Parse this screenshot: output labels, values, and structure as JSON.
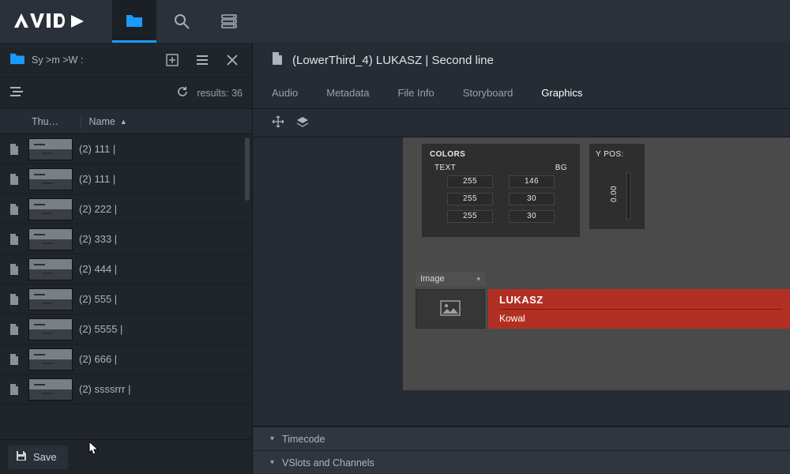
{
  "nav": {
    "tab_files": "files",
    "tab_search": "search",
    "tab_servers": "servers"
  },
  "browser": {
    "breadcrumb": "Sy  >m  >W :",
    "results_label": "results:",
    "results_count": "36",
    "col_thumb": "Thu…",
    "col_name": "Name",
    "sort_dir": "▲",
    "save_label": "Save",
    "items": [
      {
        "name": "(2) 111 |"
      },
      {
        "name": "(2) 111 |"
      },
      {
        "name": "(2) 222 |"
      },
      {
        "name": "(2) 333 |"
      },
      {
        "name": "(2) 444 |"
      },
      {
        "name": "(2) 555 |"
      },
      {
        "name": "(2) 5555 |"
      },
      {
        "name": "(2) 666 |"
      },
      {
        "name": "(2) ssssrrr |"
      }
    ]
  },
  "asset": {
    "title": "(LowerThird_4) LUKASZ | Second line",
    "tabs": {
      "audio": "Audio",
      "metadata": "Metadata",
      "fileinfo": "File Info",
      "storyboard": "Storyboard",
      "graphics": "Graphics"
    },
    "graphics": {
      "colors_label": "COLORS",
      "text_label": "TEXT",
      "bg_label": "BG",
      "ypos_label": "Y POS:",
      "ypos_value": "0.00",
      "rows": [
        {
          "text": "255",
          "bg": "146"
        },
        {
          "text": "255",
          "bg": "30"
        },
        {
          "text": "255",
          "bg": "30"
        }
      ],
      "image_dropdown": "Image",
      "line1": "LUKASZ",
      "line2": "Kowal"
    },
    "sections": {
      "timecode": "Timecode",
      "vslots": "VSlots and Channels"
    }
  }
}
